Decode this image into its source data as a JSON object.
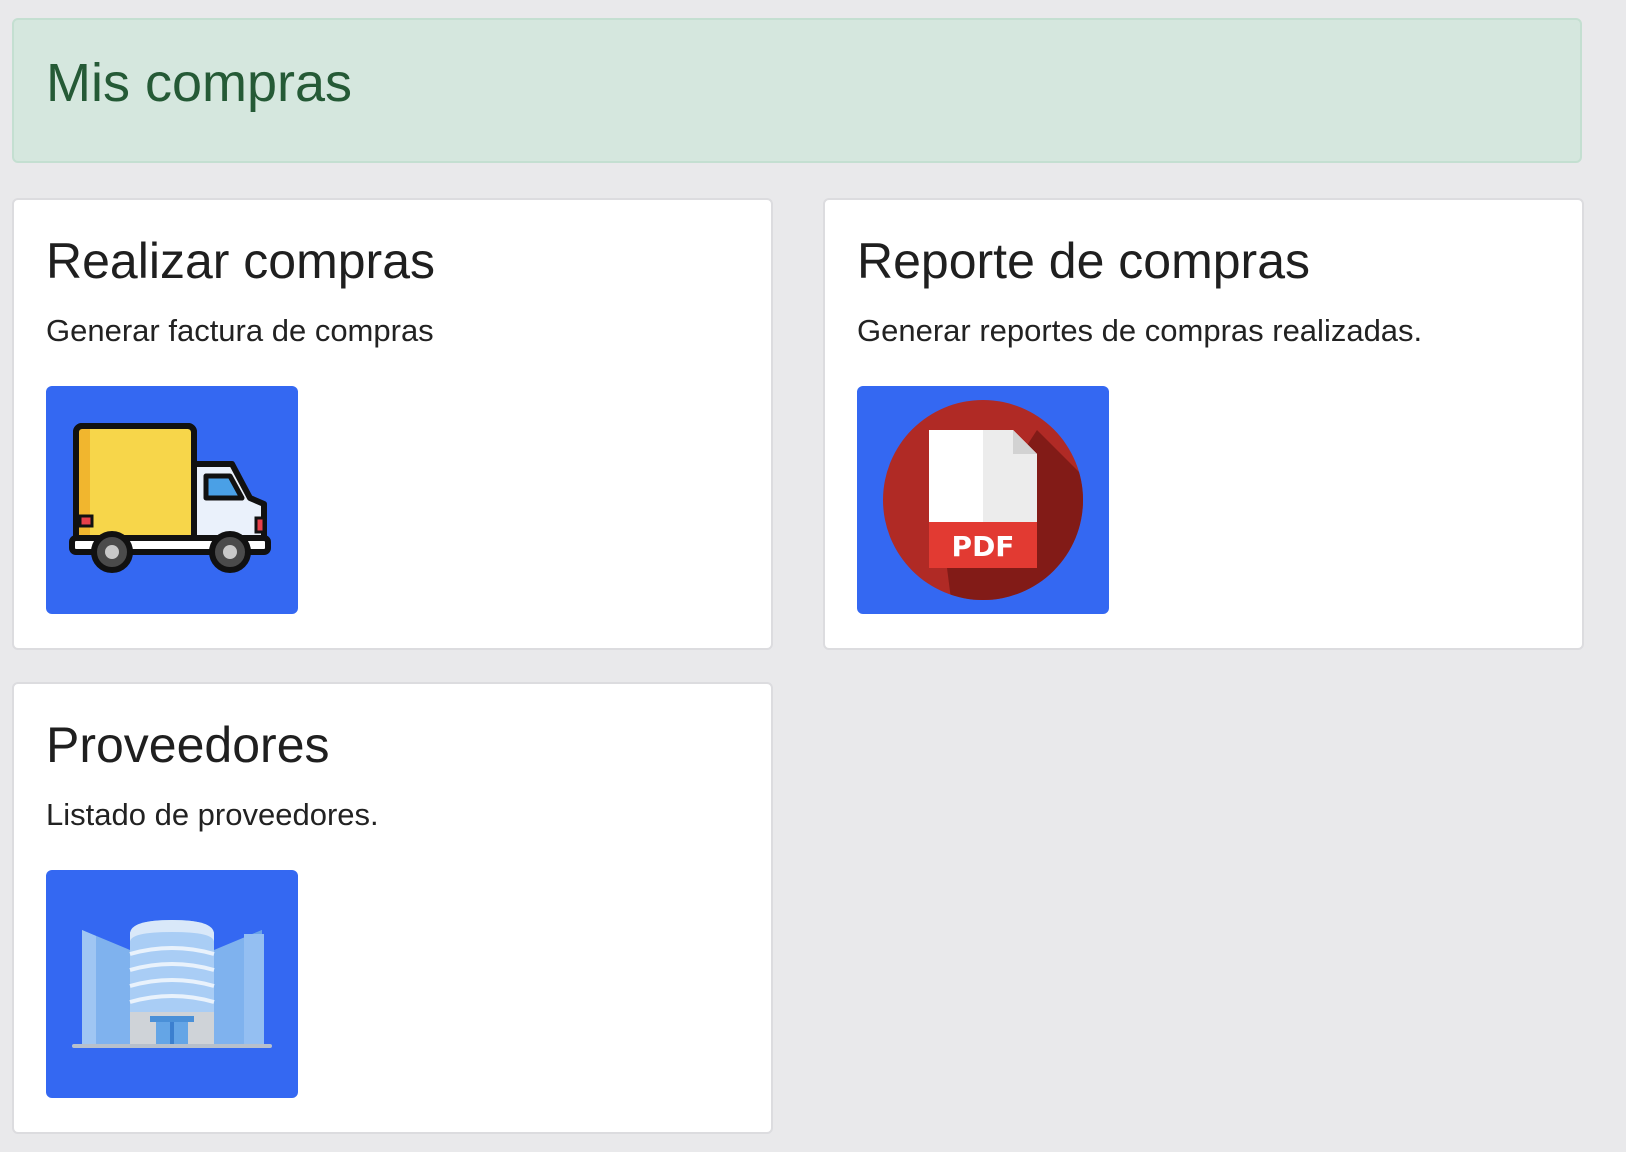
{
  "header": {
    "title": "Mis compras"
  },
  "colors": {
    "header_bg": "#d5e7de",
    "header_text": "#255a36",
    "tile_bg": "#3468f2"
  },
  "cards": [
    {
      "title": "Realizar compras",
      "description": "Generar factura de compras",
      "icon": "delivery-truck-icon"
    },
    {
      "title": "Reporte de compras",
      "description": "Generar reportes de compras realizadas.",
      "icon": "pdf-file-icon",
      "icon_text": "PDF"
    },
    {
      "title": "Proveedores",
      "description": "Listado de proveedores.",
      "icon": "office-building-icon"
    }
  ]
}
